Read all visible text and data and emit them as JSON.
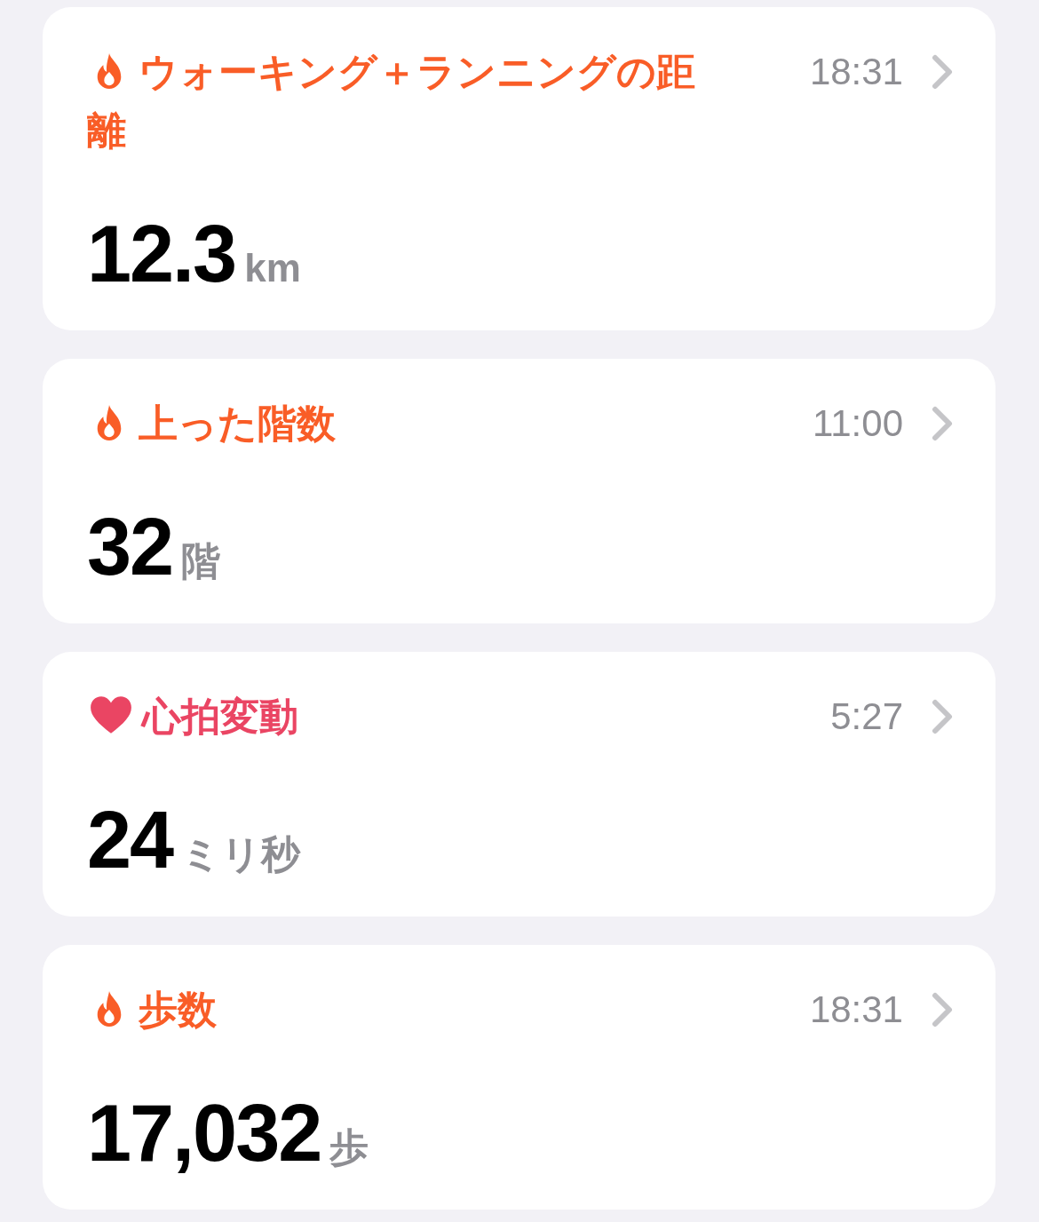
{
  "cards": [
    {
      "kind": "activity",
      "title": "ウォーキング＋ランニングの距離",
      "time": "18:31",
      "value": "12.3",
      "unit": "km"
    },
    {
      "kind": "activity",
      "title": "上った階数",
      "time": "11:00",
      "value": "32",
      "unit": "階"
    },
    {
      "kind": "heart",
      "title": "心拍変動",
      "time": "5:27",
      "value": "24",
      "unit": "ミリ秒"
    },
    {
      "kind": "activity",
      "title": "歩数",
      "time": "18:31",
      "value": "17,032",
      "unit": "歩"
    }
  ]
}
